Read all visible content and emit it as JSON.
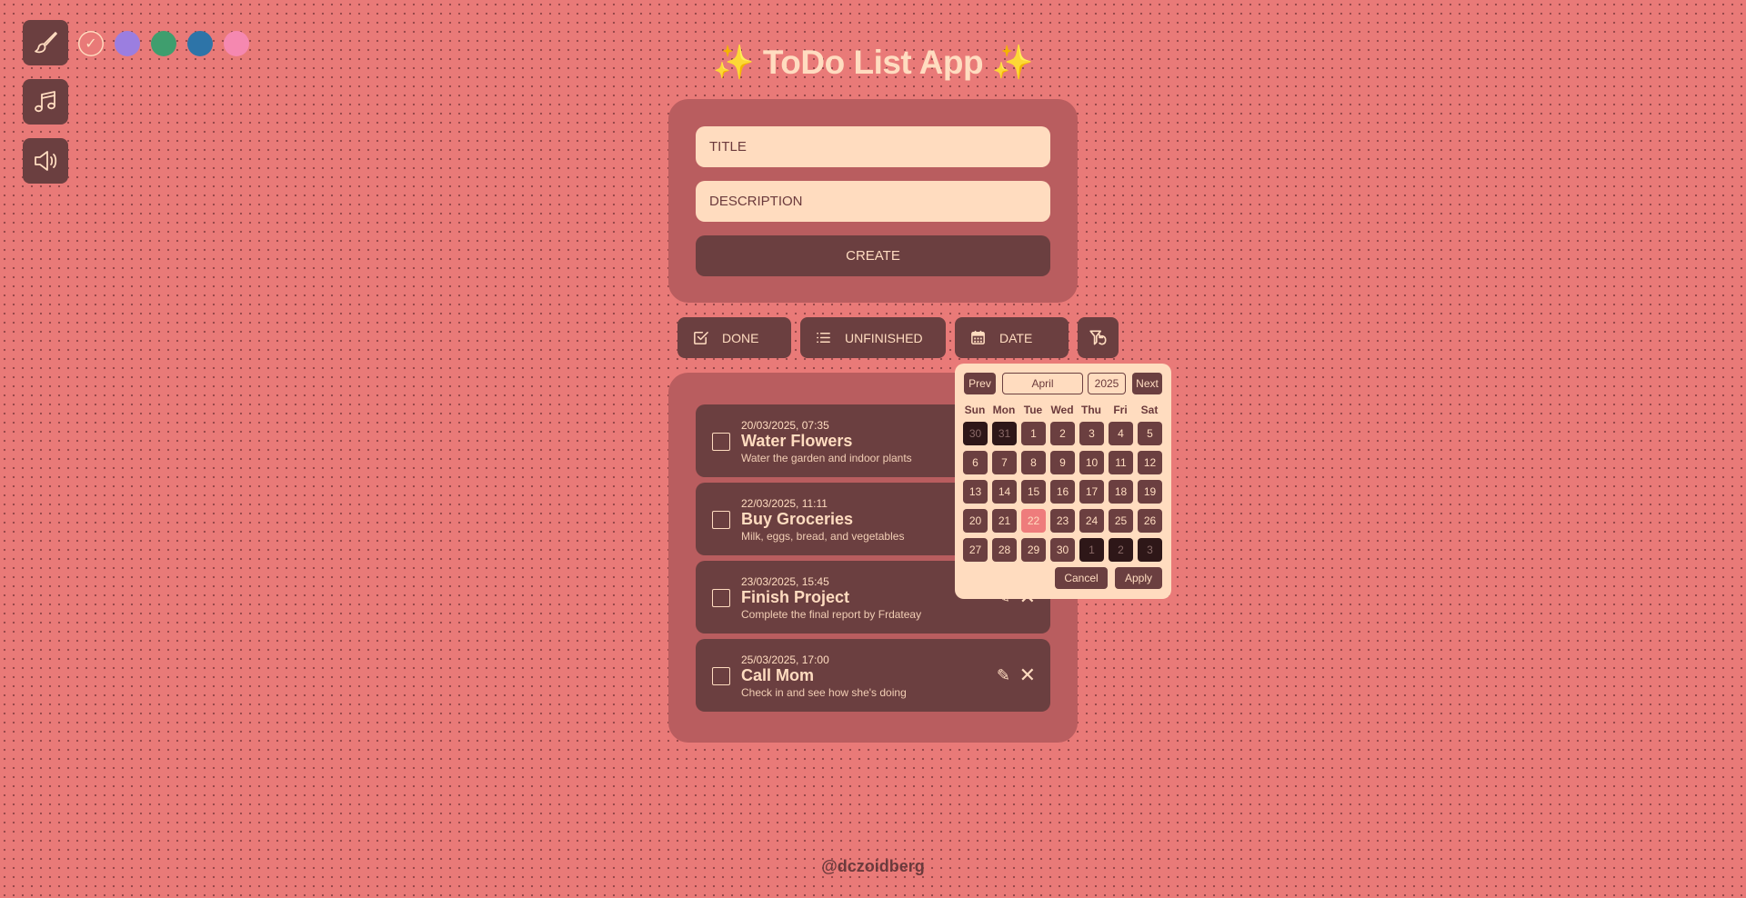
{
  "title": "✨ ToDo List App ✨",
  "swatches": [
    {
      "color": "#e97a78",
      "selected": true,
      "mark": "✓"
    },
    {
      "color": "#9b7ee0"
    },
    {
      "color": "#3f9e6e"
    },
    {
      "color": "#2d74a8"
    },
    {
      "color": "#f588b0"
    }
  ],
  "form": {
    "title_placeholder": "TITLE",
    "description_placeholder": "DESCRIPTION",
    "create_label": "CREATE"
  },
  "filters": {
    "done_label": "DONE",
    "unfinished_label": "UNFINISHED",
    "date_label": "DATE"
  },
  "tasks": [
    {
      "date": "20/03/2025, 07:35",
      "title": "Water Flowers",
      "description": "Water the garden and indoor plants"
    },
    {
      "date": "22/03/2025, 11:11",
      "title": "Buy Groceries",
      "description": "Milk, eggs, bread, and vegetables"
    },
    {
      "date": "23/03/2025, 15:45",
      "title": "Finish Project",
      "description": "Complete the final report by Frdateay"
    },
    {
      "date": "25/03/2025, 17:00",
      "title": "Call Mom",
      "description": "Check in and see how she's doing"
    }
  ],
  "task_icons": {
    "edit": "✎",
    "delete": "✕"
  },
  "datepicker": {
    "prev_label": "Prev",
    "next_label": "Next",
    "month": "April",
    "year": "2025",
    "weekdays": [
      "Sun",
      "Mon",
      "Tue",
      "Wed",
      "Thu",
      "Fri",
      "Sat"
    ],
    "days": [
      {
        "d": "30",
        "other": true
      },
      {
        "d": "31",
        "other": true
      },
      {
        "d": "1"
      },
      {
        "d": "2"
      },
      {
        "d": "3"
      },
      {
        "d": "4"
      },
      {
        "d": "5"
      },
      {
        "d": "6"
      },
      {
        "d": "7"
      },
      {
        "d": "8"
      },
      {
        "d": "9"
      },
      {
        "d": "10"
      },
      {
        "d": "11"
      },
      {
        "d": "12"
      },
      {
        "d": "13"
      },
      {
        "d": "14"
      },
      {
        "d": "15"
      },
      {
        "d": "16"
      },
      {
        "d": "17"
      },
      {
        "d": "18"
      },
      {
        "d": "19"
      },
      {
        "d": "20"
      },
      {
        "d": "21"
      },
      {
        "d": "22",
        "today": true
      },
      {
        "d": "23"
      },
      {
        "d": "24"
      },
      {
        "d": "25"
      },
      {
        "d": "26"
      },
      {
        "d": "27"
      },
      {
        "d": "28"
      },
      {
        "d": "29"
      },
      {
        "d": "30"
      },
      {
        "d": "1",
        "other": true
      },
      {
        "d": "2",
        "other": true
      },
      {
        "d": "3",
        "other": true
      }
    ],
    "cancel_label": "Cancel",
    "apply_label": "Apply"
  },
  "credit": "@dczoidberg"
}
